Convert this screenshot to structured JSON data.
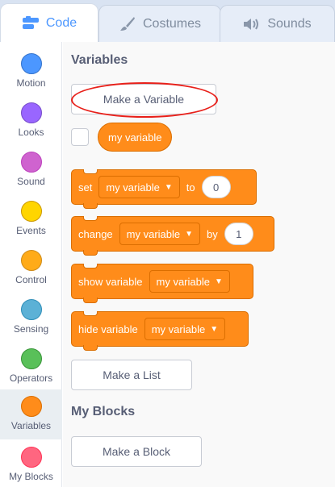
{
  "tabs": {
    "code": "Code",
    "costumes": "Costumes",
    "sounds": "Sounds"
  },
  "categories": [
    {
      "label": "Motion",
      "color": "#4c97ff"
    },
    {
      "label": "Looks",
      "color": "#9966ff"
    },
    {
      "label": "Sound",
      "color": "#cf63cf"
    },
    {
      "label": "Events",
      "color": "#ffd500"
    },
    {
      "label": "Control",
      "color": "#ffab19"
    },
    {
      "label": "Sensing",
      "color": "#5cb1d6"
    },
    {
      "label": "Operators",
      "color": "#59c059"
    },
    {
      "label": "Variables",
      "color": "#ff8c1a"
    },
    {
      "label": "My Blocks",
      "color": "#ff6680"
    }
  ],
  "palette": {
    "variables_heading": "Variables",
    "make_variable_label": "Make a Variable",
    "variable_reporter": "my variable",
    "blocks": {
      "set": {
        "label": "set",
        "variable": "my variable",
        "to_label": "to",
        "value": "0"
      },
      "change": {
        "label": "change",
        "variable": "my variable",
        "by_label": "by",
        "value": "1"
      },
      "show": {
        "label": "show variable",
        "variable": "my variable"
      },
      "hide": {
        "label": "hide variable",
        "variable": "my variable"
      }
    },
    "make_list_label": "Make a List",
    "my_blocks_heading": "My Blocks",
    "make_block_label": "Make a Block"
  },
  "colors": {
    "accent": "#4c97ff",
    "variables_block": "#ff8c1a",
    "highlight_ring": "#e8201a"
  }
}
